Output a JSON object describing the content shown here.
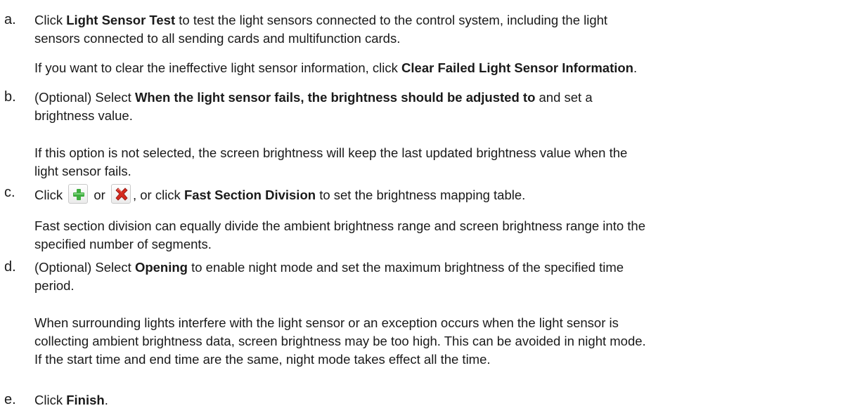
{
  "steps": [
    {
      "letter": "a.",
      "paragraphs": [
        {
          "t1": "Click ",
          "b1": "Light Sensor Test",
          "t2": " to test the light sensors connected to the control system, including the light",
          "line2": "sensors connected to all sending cards and multifunction cards."
        },
        {
          "t1": "If you want to clear the ineffective light sensor information, click ",
          "b1": "Clear Failed Light Sensor Information",
          "t2": "."
        }
      ]
    },
    {
      "letter": "b.",
      "paragraphs": [
        {
          "t1": "(Optional) Select ",
          "b1": "When the light sensor fails, the brightness should be adjusted to",
          "t2": " and set a",
          "line2": "brightness value."
        },
        {
          "line1": "If this option is not selected, the screen brightness will keep the last updated brightness value when the",
          "line2": "light sensor fails."
        }
      ]
    },
    {
      "letter": "c.",
      "paragraphs": [
        {
          "t1": "Click ",
          "t_or": " or ",
          "t2": ", or click ",
          "b1": "Fast Section Division",
          "t3": " to set the brightness mapping table."
        },
        {
          "line1": "Fast section division can equally divide the ambient brightness range and screen brightness range into the",
          "line2": "specified number of segments."
        }
      ]
    },
    {
      "letter": "d.",
      "paragraphs": [
        {
          "t1": "(Optional) Select ",
          "b1": "Opening",
          "t2": " to enable night mode and set the maximum brightness of the specified time",
          "line2": "period."
        },
        {
          "line1": "When surrounding lights interfere with the light sensor or an exception occurs when the light sensor is",
          "line2": "collecting ambient brightness data, screen brightness may be too high. This can be avoided in night mode.",
          "line3": "If the start time and end time are the same, night mode takes effect all the time."
        }
      ]
    },
    {
      "letter": "e.",
      "paragraphs": [
        {
          "t1": "Click ",
          "b1": "Finish",
          "t2": "."
        }
      ]
    }
  ],
  "icons": {
    "add": "add-green-plus-icon",
    "delete": "delete-red-x-icon"
  },
  "colors": {
    "plus_green": "#3fae3f",
    "x_red": "#d42a1e"
  }
}
